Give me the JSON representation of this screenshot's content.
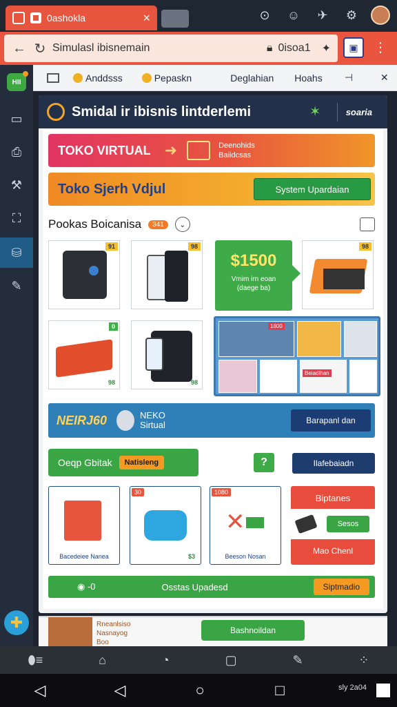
{
  "browser": {
    "tab_title": "0ashokla",
    "tab_close": "×",
    "url": "Simulasl ibisnemain",
    "zoom_label": "0isoa1",
    "menu": "⋮"
  },
  "app_toolbar": {
    "items": [
      "Anddsss",
      "Pepaskn",
      "Deglahian",
      "Hoahs"
    ]
  },
  "panel": {
    "title": "Smidal ir ibisnis lintderlemi",
    "badge": "soaria"
  },
  "banner1": {
    "title": "TOKO VIRTUAL",
    "subtitle_1": "Deenohids",
    "subtitle_2": "Baiidcsas"
  },
  "banner2": {
    "title": "Toko Sjerh Vdjul",
    "button": "System Upardaian"
  },
  "section": {
    "title": "Pookas Boicanisa",
    "pill": "341"
  },
  "cards": [
    {
      "tag": "91"
    },
    {
      "tag": "98"
    },
    {
      "tag": "98"
    },
    {
      "tag": "0",
      "foot": "98"
    },
    {
      "foot": "98"
    }
  ],
  "price": {
    "value": "$1500",
    "line1": "Vmim irn eoan",
    "line2": "(daege ba)"
  },
  "collage": {
    "badge1": "1800",
    "badge2": "Beiadlhan"
  },
  "banner3": {
    "brand": "NEIRJ60",
    "line1": "NEKO",
    "line2": "Sirtual",
    "button": "Barapanl dan"
  },
  "row6": {
    "green_label": "Oeqp Gbitak",
    "orange_label": "Natisleng",
    "info": "?",
    "blue_button": "Ilafebaiadn"
  },
  "tiles": [
    {
      "label": "Bacedeiee Nanea"
    },
    {
      "badge": "30",
      "foot": "$3"
    },
    {
      "badge": "1080",
      "label": "Beeson Nosan"
    }
  ],
  "promo": {
    "top": "Biptanes",
    "button": "Sesos",
    "bottom": "Mao Chenl"
  },
  "statusbar": {
    "left": "-0",
    "middle": "Osstas Upadesd",
    "button": "Siptmadio"
  },
  "peek": {
    "line1": "Rneanlsiso",
    "line2": "Nasnayog",
    "line3": "Boo",
    "button": "Bashnoildan"
  },
  "system": {
    "time": "sly 2a04"
  },
  "colors": {
    "accent": "#e8553e",
    "green": "#3aa544",
    "navy": "#23304a"
  }
}
